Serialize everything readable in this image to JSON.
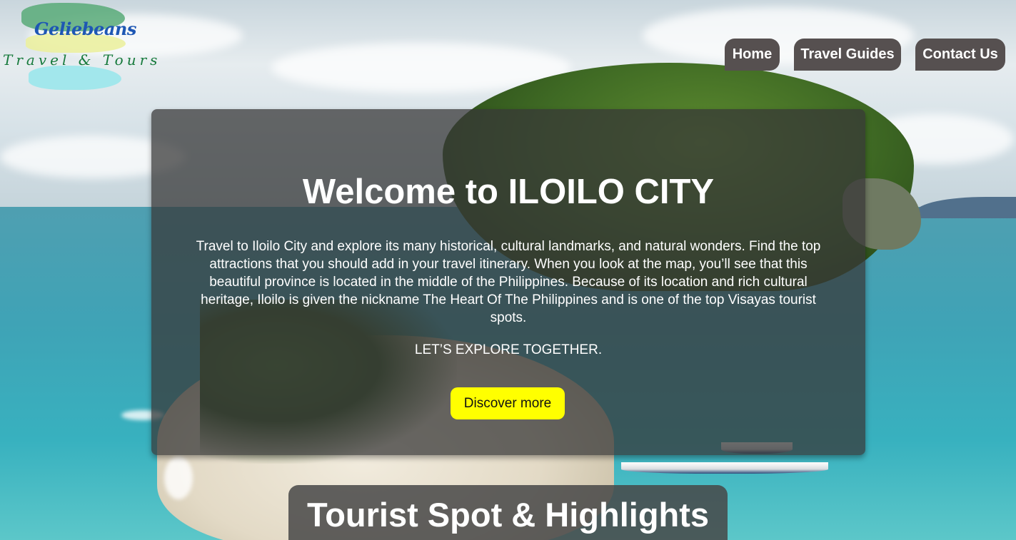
{
  "logo": {
    "line1": "Geliebeans",
    "line2": "Travel & Tours"
  },
  "nav": {
    "items": [
      {
        "label": "Home"
      },
      {
        "label": "Travel Guides"
      },
      {
        "label": "Contact Us"
      }
    ]
  },
  "hero": {
    "title": "Welcome to ILOILO CITY",
    "description": "Travel to Iloilo City and explore its many historical, cultural landmarks, and natural wonders. Find the top attractions that you should add in your travel itinerary. When you look at the map, you’ll see that this beautiful province is located in the middle of the Philippines. Because of its location and rich cultural heritage, Iloilo is given the nickname The Heart Of The Philippines and is one of the top Visayas tourist spots.",
    "tagline": "LET’S EXPLORE TOGETHER.",
    "cta_label": "Discover more"
  },
  "section": {
    "heading": "Tourist Spot & Highlights"
  },
  "colors": {
    "nav_bg": "#565050",
    "card_bg": "rgba(55,55,55,0.74)",
    "cta_bg": "#ffff00",
    "logo_blue": "#1e57b4",
    "logo_green": "#177a3c"
  }
}
